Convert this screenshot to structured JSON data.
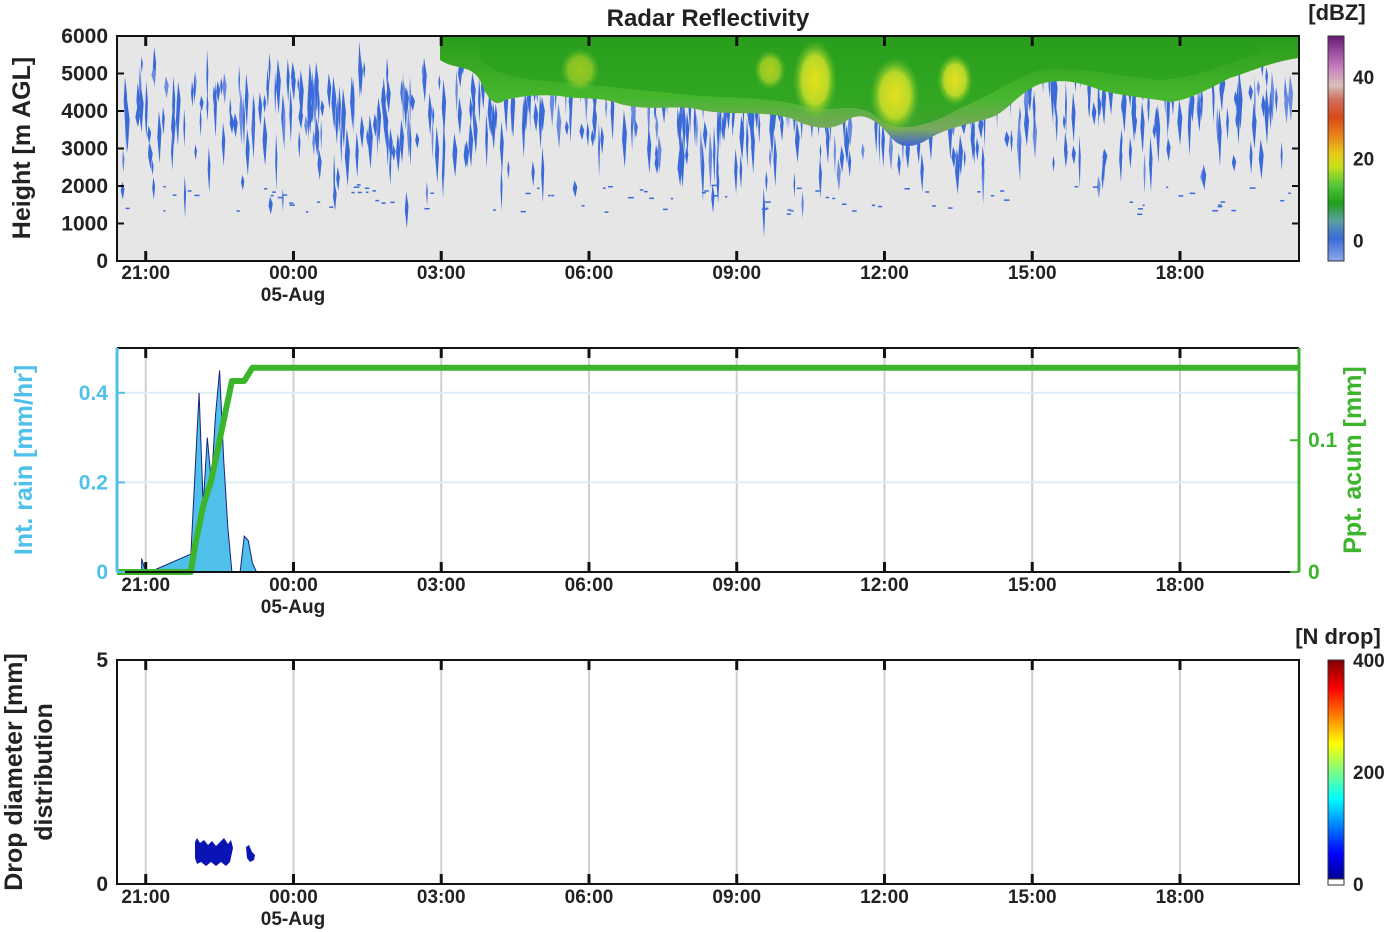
{
  "colors": {
    "background_plot": "#e6e6e6",
    "rain_axis": "#4ec0ea",
    "rain_fill": "#4ec0ea",
    "rain_outline": "#1a237e",
    "accum_line": "#3cb52c",
    "grid": "#d0d0d0",
    "dsd_color": "#0a14b4"
  },
  "x_ticks": [
    "21:00",
    "00:00",
    "03:00",
    "06:00",
    "09:00",
    "12:00",
    "15:00",
    "18:00"
  ],
  "x_date_label": "05-Aug",
  "panel1": {
    "title": "Radar Reflectivity",
    "ylabel": "Height [m AGL]",
    "yticks": [
      "0",
      "1000",
      "2000",
      "3000",
      "4000",
      "5000",
      "6000"
    ],
    "colorbar_title": "[dBZ]",
    "colorbar_ticks": [
      "0",
      "20",
      "40"
    ]
  },
  "panel2": {
    "ylabel_left": "Int. rain [mm/hr]",
    "ylabel_right": "Ppt. acum [mm]",
    "yticks_left": [
      "0",
      "0.2",
      "0.4"
    ],
    "yticks_right": [
      "0",
      "0.1"
    ]
  },
  "panel3": {
    "ylabel_line1": "Drop diameter [mm]",
    "ylabel_line2": "distribution",
    "yticks": [
      "0",
      "5"
    ],
    "colorbar_title": "[N drop]",
    "colorbar_ticks": [
      "0",
      "200",
      "400"
    ]
  },
  "chart_data": [
    {
      "type": "heatmap",
      "title": "Radar Reflectivity",
      "ylabel": "Height [m AGL]",
      "ylim": [
        0,
        6000
      ],
      "x_range": [
        "20:25",
        "20:25 +24h"
      ],
      "colorbar": {
        "title": "[dBZ]",
        "ticks": [
          0,
          20,
          40
        ],
        "range": [
          -5,
          50
        ]
      },
      "echo_top_m": [
        {
          "x": "21:00",
          "top": 6000,
          "base": 1500,
          "max_dbz": 2
        },
        {
          "x": "00:00",
          "top": 6000,
          "base": 1500,
          "max_dbz": 2
        },
        {
          "x": "03:00",
          "top": 6000,
          "base": 1500,
          "max_dbz": 5
        },
        {
          "x": "04:00",
          "top": 6000,
          "base": 1200,
          "max_dbz": 12
        },
        {
          "x": "06:00",
          "top": 6000,
          "base": 1200,
          "max_dbz": 15
        },
        {
          "x": "09:00",
          "top": 6000,
          "base": 1200,
          "max_dbz": 18
        },
        {
          "x": "10:40",
          "top": 6000,
          "base": 1200,
          "max_dbz": 22
        },
        {
          "x": "12:00",
          "top": 6000,
          "base": 1200,
          "max_dbz": 22
        },
        {
          "x": "14:00",
          "top": 6000,
          "base": 1200,
          "max_dbz": 16
        },
        {
          "x": "15:00",
          "top": 6000,
          "base": 1200,
          "max_dbz": 5
        },
        {
          "x": "17:00",
          "top": 6000,
          "base": 1200,
          "max_dbz": 12
        },
        {
          "x": "19:30",
          "top": 6000,
          "base": 1200,
          "max_dbz": 5
        }
      ]
    },
    {
      "type": "line",
      "series": [
        {
          "name": "Int. rain [mm/hr]",
          "axis": "left",
          "ylim": [
            0,
            0.5
          ],
          "x": [
            "20:55",
            "21:00",
            "21:05",
            "21:55",
            "22:05",
            "22:10",
            "22:15",
            "22:20",
            "22:25",
            "22:30",
            "22:35",
            "22:40",
            "22:45",
            "22:50",
            "22:55",
            "23:00",
            "23:05",
            "23:10",
            "23:15"
          ],
          "y": [
            0.03,
            0.0,
            0.0,
            0.04,
            0.4,
            0.15,
            0.3,
            0.2,
            0.35,
            0.45,
            0.25,
            0.1,
            0.0,
            0.0,
            0.0,
            0.08,
            0.07,
            0.02,
            0.0
          ]
        },
        {
          "name": "Ppt. acum [mm]",
          "axis": "right",
          "ylim": [
            0,
            0.17
          ],
          "x": [
            "20:25",
            "21:55",
            "22:00",
            "22:10",
            "22:20",
            "22:30",
            "22:40",
            "22:45",
            "23:00",
            "23:10",
            "20:25 +24h"
          ],
          "y": [
            0.0,
            0.0,
            0.02,
            0.05,
            0.07,
            0.1,
            0.13,
            0.145,
            0.145,
            0.155,
            0.155
          ]
        }
      ]
    },
    {
      "type": "heatmap",
      "ylabel": "Drop diameter [mm] distribution",
      "ylim": [
        0,
        5
      ],
      "colorbar": {
        "title": "[N drop]",
        "ticks": [
          0,
          200,
          400
        ],
        "range": [
          0,
          400
        ]
      },
      "patches": [
        {
          "x_start": "22:05",
          "x_end": "22:50",
          "diameter_min": 0.4,
          "diameter_max": 1.0,
          "n_drop": 20
        },
        {
          "x_start": "23:05",
          "x_end": "23:15",
          "diameter_min": 0.5,
          "diameter_max": 0.8,
          "n_drop": 10
        }
      ]
    }
  ]
}
